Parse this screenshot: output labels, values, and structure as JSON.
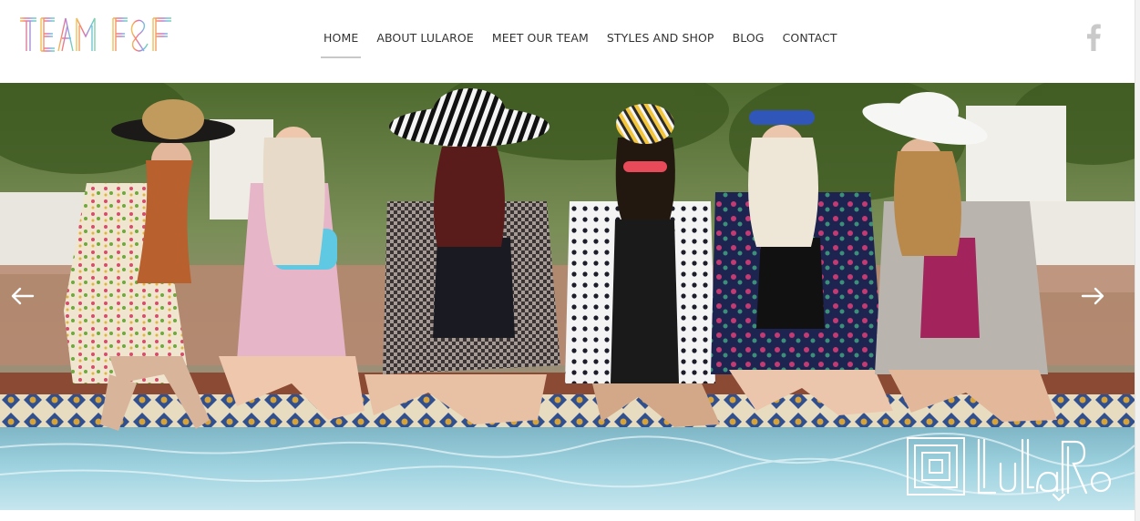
{
  "site": {
    "logo_text": "TEAM F&F"
  },
  "nav": {
    "items": [
      {
        "label": "HOME",
        "active": true
      },
      {
        "label": "ABOUT LULAROE",
        "active": false
      },
      {
        "label": "MEET OUR TEAM",
        "active": false
      },
      {
        "label": "STYLES AND SHOP",
        "active": false
      },
      {
        "label": "BLOG",
        "active": false
      },
      {
        "label": "CONTACT",
        "active": false
      }
    ]
  },
  "social": {
    "icon": "facebook-icon",
    "color": "#c9c9c9"
  },
  "slider": {
    "prev_icon": "arrow-left-icon",
    "next_icon": "arrow-right-icon",
    "watermark_text": "LuLaRoe"
  },
  "colors": {
    "nav_text": "#333333",
    "active_underline": "#c8c8c8",
    "logo_gradient": [
      "#f2c14e",
      "#f47a7a",
      "#b980d6",
      "#6fc3df",
      "#7fd1a8"
    ]
  }
}
